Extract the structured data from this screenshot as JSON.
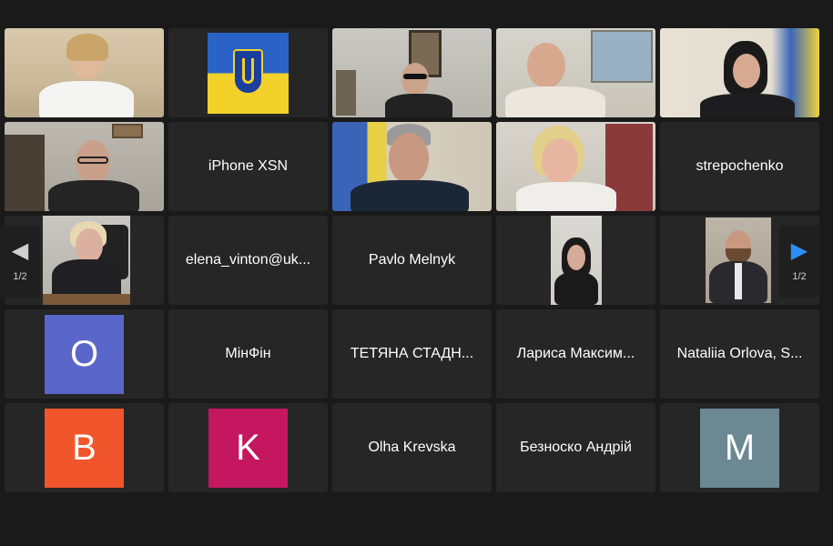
{
  "tiles": [
    {
      "type": "video",
      "description_id": "woman-white-blouse"
    },
    {
      "type": "video",
      "description_id": "ukraine-eu-flag"
    },
    {
      "type": "video",
      "description_id": "man-glasses-office"
    },
    {
      "type": "video",
      "description_id": "bald-man-light-shirt"
    },
    {
      "type": "video",
      "description_id": "woman-dark-hair-flag"
    },
    {
      "type": "video",
      "description_id": "man-glasses-office-2"
    },
    {
      "type": "name",
      "label": "iPhone XSN"
    },
    {
      "type": "video",
      "description_id": "man-grey-hair-flag"
    },
    {
      "type": "video",
      "description_id": "blonde-woman"
    },
    {
      "type": "name",
      "label": "strepochenko"
    },
    {
      "type": "video",
      "description_id": "woman-blonde-desk"
    },
    {
      "type": "name",
      "label": "elena_vinton@uk..."
    },
    {
      "type": "name",
      "label": "Pavlo Melnyk"
    },
    {
      "type": "video",
      "description_id": "woman-portrait-phone"
    },
    {
      "type": "video",
      "description_id": "man-beard-portrait",
      "active": true
    },
    {
      "type": "avatar",
      "letter": "O",
      "color": "#5a66c9"
    },
    {
      "type": "name",
      "label": "МінФін"
    },
    {
      "type": "name",
      "label": "ТЕТЯНА СТАДН..."
    },
    {
      "type": "name",
      "label": "Лариса Максим..."
    },
    {
      "type": "name",
      "label": "Nataliia Orlova, S..."
    },
    {
      "type": "avatar",
      "letter": "B",
      "color": "#f0552b"
    },
    {
      "type": "avatar",
      "letter": "K",
      "color": "#c4175f"
    },
    {
      "type": "name",
      "label": "Olha Krevska"
    },
    {
      "type": "name",
      "label": "Безноско Андрій"
    },
    {
      "type": "avatar",
      "letter": "M",
      "color": "#6b8893"
    }
  ],
  "nav": {
    "prev_page": "1/2",
    "next_page": "1/2"
  },
  "colors": {
    "active_speaker": "#3fbf5a",
    "nav_arrow_active": "#2e8ef7"
  }
}
